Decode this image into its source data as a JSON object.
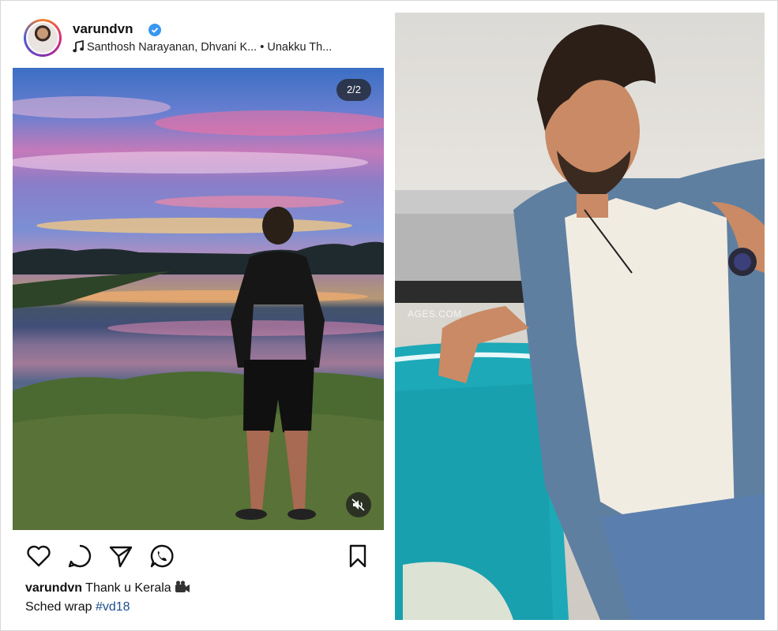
{
  "post": {
    "username": "varundvn",
    "audio_artists": "Santhosh Narayanan, Dhvani K...",
    "audio_separator": "•",
    "audio_track": "Unakku Th...",
    "slide_counter": "2/2",
    "caption_user": "varundvn",
    "caption_text": "Thank u Kerala",
    "caption_line2": "Sched wrap",
    "hashtag": "#vd18",
    "icons": [
      "heart-icon",
      "comment-icon",
      "share-icon",
      "whatsapp-icon",
      "bookmark-icon",
      "mute-icon",
      "verified-icon",
      "music-note-icon",
      "clapper-icon"
    ]
  },
  "portrait": {
    "watermark": "AGES.COM"
  },
  "colors": {
    "verified": "#3897f0",
    "hashtag": "#1f4e8c",
    "text": "#111111"
  }
}
